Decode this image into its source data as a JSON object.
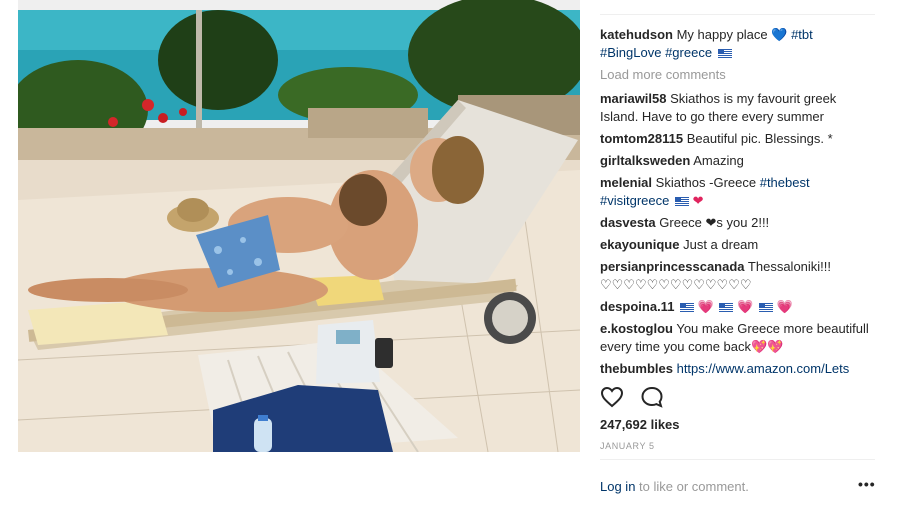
{
  "post": {
    "author": "katehudson",
    "caption": "My happy place 💙",
    "caption_tags": [
      "#tbt",
      "#BingLove",
      "#greece"
    ],
    "load_more": "Load more comments",
    "comments": [
      {
        "user": "mariawil58",
        "text": "Skiathos is my favourit greek Island. Have to go there every summer"
      },
      {
        "user": "tomtom28115",
        "text": "Beautiful pic. Blessings. *"
      },
      {
        "user": "girltalksweden",
        "text": "Amazing"
      },
      {
        "user": "melenial",
        "text": "Skiathos -Greece",
        "tags": "#thebest #visitgreece"
      },
      {
        "user": "dasvesta",
        "text": "Greece ❤s you 2!!!"
      },
      {
        "user": "ekayounique",
        "text": "Just a dream"
      },
      {
        "user": "persianprincesscanada",
        "text": "Thessaloniki!!! ♡♡♡♡♡♡♡♡♡♡♡♡♡"
      },
      {
        "user": "despoina.11",
        "text": ""
      },
      {
        "user": "e.kostoglou",
        "text": "You make Greece more beautifull every time you come back💖💖"
      },
      {
        "user": "thebumbles",
        "text": "https://www.amazon.com/Lets"
      }
    ],
    "likes": "247,692 likes",
    "date": "JANUARY 5",
    "login_link": "Log in",
    "login_rest": " to like or comment.",
    "more_icon": "•••"
  },
  "icons": {
    "like": "heart-outline-icon",
    "comment": "speech-bubble-icon",
    "more": "ellipsis-icon"
  },
  "colors": {
    "link": "#003569",
    "muted": "#999999",
    "text": "#262626"
  }
}
